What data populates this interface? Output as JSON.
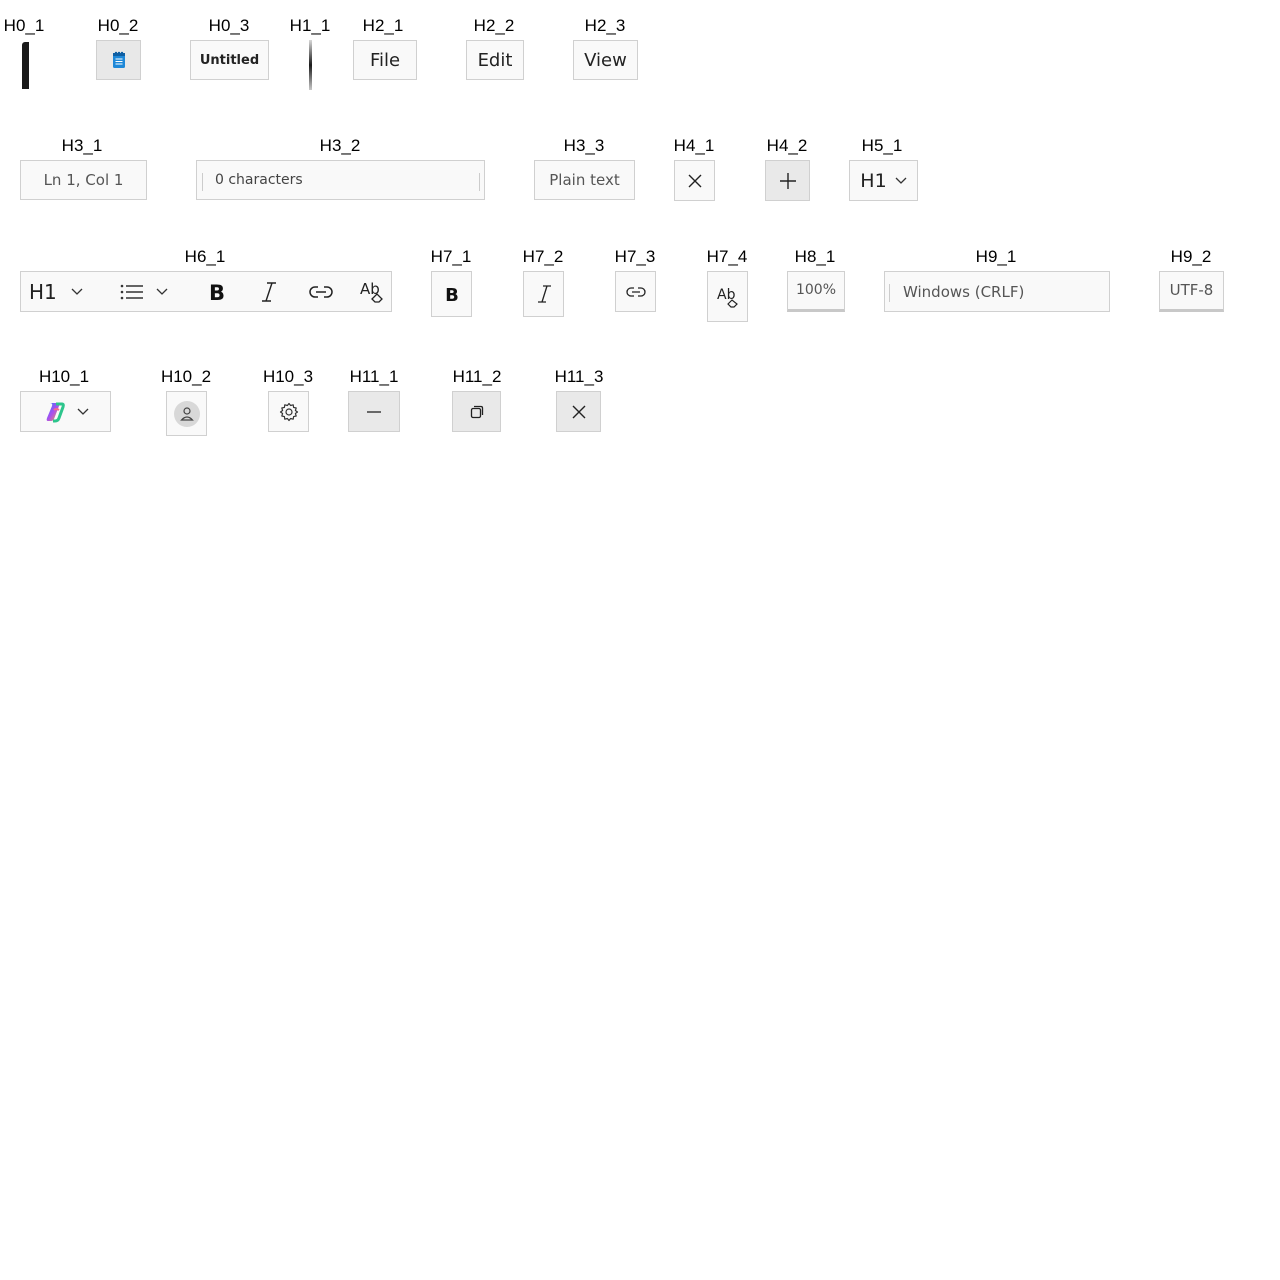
{
  "captions": {
    "H0_1": "H0_1",
    "H0_2": "H0_2",
    "H0_3": "H0_3",
    "H1_1": "H1_1",
    "H2_1": "H2_1",
    "H2_2": "H2_2",
    "H2_3": "H2_3",
    "H3_1": "H3_1",
    "H3_2": "H3_2",
    "H3_3": "H3_3",
    "H4_1": "H4_1",
    "H4_2": "H4_2",
    "H5_1": "H5_1",
    "H6_1": "H6_1",
    "H7_1": "H7_1",
    "H7_2": "H7_2",
    "H7_3": "H7_3",
    "H7_4": "H7_4",
    "H8_1": "H8_1",
    "H9_1": "H9_1",
    "H9_2": "H9_2",
    "H10_1": "H10_1",
    "H10_2": "H10_2",
    "H10_3": "H10_3",
    "H11_1": "H11_1",
    "H11_2": "H11_2",
    "H11_3": "H11_3"
  },
  "titlebar": {
    "app_icon": "notepad-icon",
    "tab_title": "Untitled"
  },
  "menu": {
    "file": "File",
    "edit": "Edit",
    "view": "View"
  },
  "status": {
    "position": "Ln 1, Col 1",
    "char_count": "0 characters",
    "format": "Plain text",
    "zoom": "100%",
    "line_ending": "Windows (CRLF)",
    "encoding": "UTF-8"
  },
  "tabs": {
    "close_icon": "close-icon",
    "add_icon": "plus-icon"
  },
  "heading_select": {
    "value": "H1"
  },
  "toolbar": {
    "heading_value": "H1",
    "icons": [
      "list-icon",
      "bold-icon",
      "italic-icon",
      "link-icon",
      "clear-formatting-icon"
    ]
  },
  "format_buttons": {
    "bold_icon": "bold-icon",
    "italic_icon": "italic-icon",
    "link_icon": "link-icon",
    "clear_icon": "clear-formatting-icon"
  },
  "right_tools": {
    "copilot_icon": "copilot-icon",
    "account_icon": "account-icon",
    "settings_icon": "gear-icon"
  },
  "window_controls": {
    "minimize_icon": "minimize-icon",
    "restore_icon": "restore-icon",
    "close_icon": "close-icon"
  },
  "colors": {
    "notepad_blue": "#1e88d8",
    "copilot_gradient": [
      "#2f7ff8",
      "#a94ef0",
      "#f2a33a",
      "#2dc58c"
    ]
  }
}
